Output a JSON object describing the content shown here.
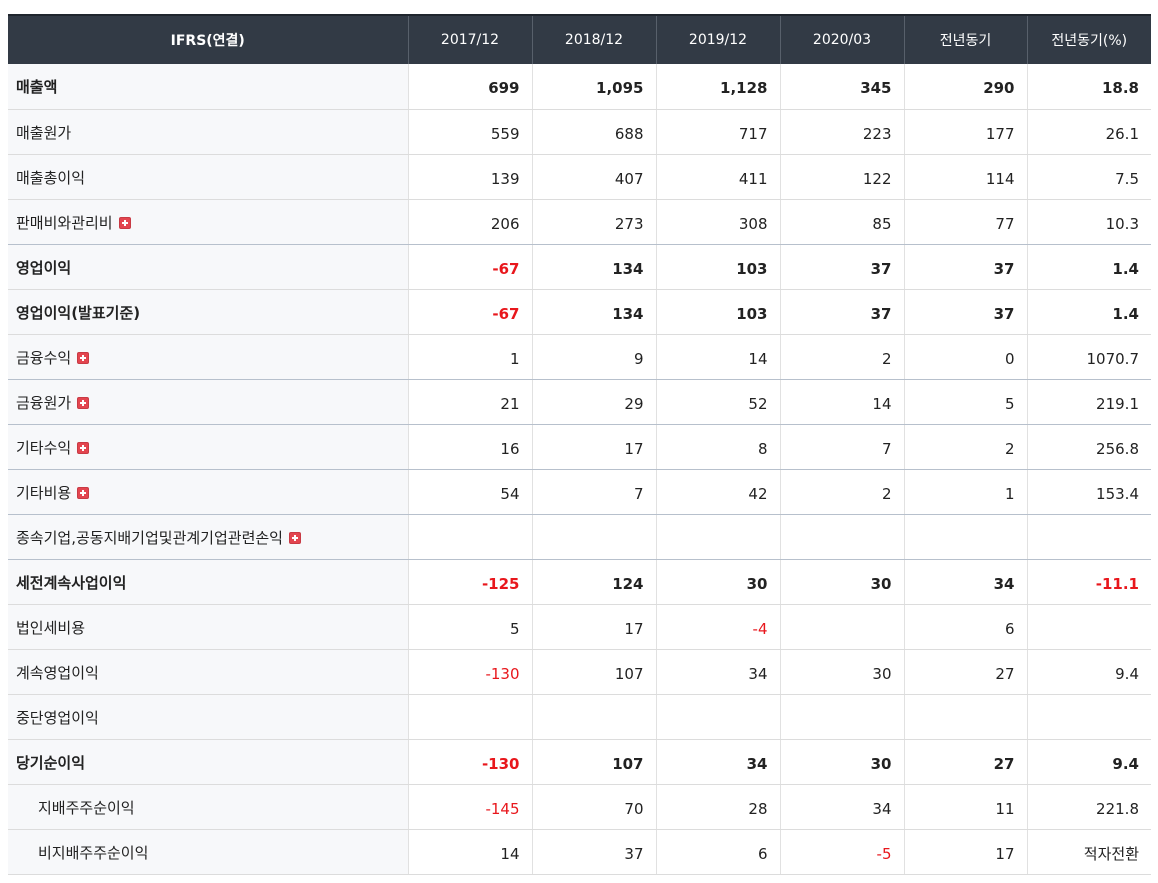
{
  "table": {
    "headers": [
      "IFRS(연결)",
      "2017/12",
      "2018/12",
      "2019/12",
      "2020/03",
      "전년동기",
      "전년동기(%)"
    ],
    "rows": [
      {
        "label": "매출액",
        "bold": true,
        "expand": false,
        "sub": false,
        "values": [
          "699",
          "1,095",
          "1,128",
          "345",
          "290",
          "18.8"
        ],
        "neg": [
          false,
          false,
          false,
          false,
          false,
          false
        ]
      },
      {
        "label": "매출원가",
        "bold": false,
        "expand": false,
        "sub": false,
        "values": [
          "559",
          "688",
          "717",
          "223",
          "177",
          "26.1"
        ],
        "neg": [
          false,
          false,
          false,
          false,
          false,
          false
        ]
      },
      {
        "label": "매출총이익",
        "bold": false,
        "expand": false,
        "sub": false,
        "values": [
          "139",
          "407",
          "411",
          "122",
          "114",
          "7.5"
        ],
        "neg": [
          false,
          false,
          false,
          false,
          false,
          false
        ]
      },
      {
        "label": "판매비와관리비",
        "bold": false,
        "expand": true,
        "sub": false,
        "sep": true,
        "values": [
          "206",
          "273",
          "308",
          "85",
          "77",
          "10.3"
        ],
        "neg": [
          false,
          false,
          false,
          false,
          false,
          false
        ]
      },
      {
        "label": "영업이익",
        "bold": true,
        "expand": false,
        "sub": false,
        "values": [
          "-67",
          "134",
          "103",
          "37",
          "37",
          "1.4"
        ],
        "neg": [
          true,
          false,
          false,
          false,
          false,
          false
        ]
      },
      {
        "label": "영업이익(발표기준)",
        "bold": true,
        "expand": false,
        "sub": false,
        "values": [
          "-67",
          "134",
          "103",
          "37",
          "37",
          "1.4"
        ],
        "neg": [
          true,
          false,
          false,
          false,
          false,
          false
        ]
      },
      {
        "label": "금융수익",
        "bold": false,
        "expand": true,
        "sub": false,
        "sep": true,
        "values": [
          "1",
          "9",
          "14",
          "2",
          "0",
          "1070.7"
        ],
        "neg": [
          false,
          false,
          false,
          false,
          false,
          false
        ]
      },
      {
        "label": "금융원가",
        "bold": false,
        "expand": true,
        "sub": false,
        "sep": true,
        "values": [
          "21",
          "29",
          "52",
          "14",
          "5",
          "219.1"
        ],
        "neg": [
          false,
          false,
          false,
          false,
          false,
          false
        ]
      },
      {
        "label": "기타수익",
        "bold": false,
        "expand": true,
        "sub": false,
        "sep": true,
        "values": [
          "16",
          "17",
          "8",
          "7",
          "2",
          "256.8"
        ],
        "neg": [
          false,
          false,
          false,
          false,
          false,
          false
        ]
      },
      {
        "label": "기타비용",
        "bold": false,
        "expand": true,
        "sub": false,
        "sep": true,
        "values": [
          "54",
          "7",
          "42",
          "2",
          "1",
          "153.4"
        ],
        "neg": [
          false,
          false,
          false,
          false,
          false,
          false
        ]
      },
      {
        "label": "종속기업,공동지배기업및관계기업관련손익",
        "bold": false,
        "expand": true,
        "sub": false,
        "sep": true,
        "values": [
          "",
          "",
          "",
          "",
          "",
          ""
        ],
        "neg": [
          false,
          false,
          false,
          false,
          false,
          false
        ]
      },
      {
        "label": "세전계속사업이익",
        "bold": true,
        "expand": false,
        "sub": false,
        "values": [
          "-125",
          "124",
          "30",
          "30",
          "34",
          "-11.1"
        ],
        "neg": [
          true,
          false,
          false,
          false,
          false,
          true
        ]
      },
      {
        "label": "법인세비용",
        "bold": false,
        "expand": false,
        "sub": false,
        "values": [
          "5",
          "17",
          "-4",
          "",
          "6",
          ""
        ],
        "neg": [
          false,
          false,
          true,
          false,
          false,
          false
        ]
      },
      {
        "label": "계속영업이익",
        "bold": false,
        "expand": false,
        "sub": false,
        "values": [
          "-130",
          "107",
          "34",
          "30",
          "27",
          "9.4"
        ],
        "neg": [
          true,
          false,
          false,
          false,
          false,
          false
        ]
      },
      {
        "label": "중단영업이익",
        "bold": false,
        "expand": false,
        "sub": false,
        "values": [
          "",
          "",
          "",
          "",
          "",
          ""
        ],
        "neg": [
          false,
          false,
          false,
          false,
          false,
          false
        ]
      },
      {
        "label": "당기순이익",
        "bold": true,
        "expand": false,
        "sub": false,
        "values": [
          "-130",
          "107",
          "34",
          "30",
          "27",
          "9.4"
        ],
        "neg": [
          true,
          false,
          false,
          false,
          false,
          false
        ]
      },
      {
        "label": "지배주주순이익",
        "bold": false,
        "expand": false,
        "sub": true,
        "values": [
          "-145",
          "70",
          "28",
          "34",
          "11",
          "221.8"
        ],
        "neg": [
          true,
          false,
          false,
          false,
          false,
          false
        ]
      },
      {
        "label": "비지배주주순이익",
        "bold": false,
        "expand": false,
        "sub": true,
        "values": [
          "14",
          "37",
          "6",
          "-5",
          "17",
          "적자전환"
        ],
        "neg": [
          false,
          false,
          false,
          true,
          false,
          false
        ]
      }
    ]
  }
}
